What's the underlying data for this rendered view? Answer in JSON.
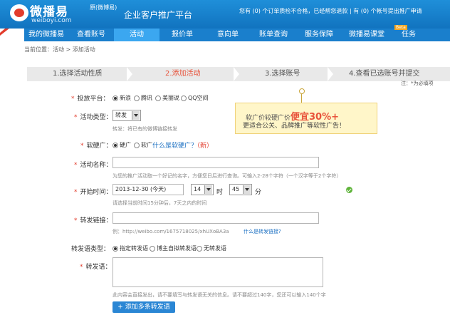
{
  "header": {
    "logo_name": "微播易",
    "logo_sub": "原(微博易)",
    "logo_domain": "weiboyi.com",
    "platform": "企业客户推广平台",
    "notice": "您有 (0) 个订单质检不合格，已经帮您退款 | 有 (0) 个帐号提出推广申请"
  },
  "nav": {
    "tabs": [
      "我的微播易",
      "查看账号",
      "活动",
      "报价单",
      "意向单",
      "账单查询",
      "服务保障",
      "微播易课堂",
      "任务"
    ],
    "active": "活动",
    "beta": "Beta"
  },
  "breadcrumb": "当前位置：活动 > 添加活动",
  "steps": [
    "1.选择活动性质",
    "2.添加活动",
    "3.选择账号",
    "4.查看已选账号并提交"
  ],
  "required_note": "注：*为必填项",
  "form": {
    "platform_label": "投放平台：",
    "platform_options": [
      "新浪",
      "腾讯",
      "美丽说",
      "QQ空间"
    ],
    "type_label": "活动类型：",
    "type_value": "转发",
    "type_hint": "转发：将已有的微博链接转发",
    "ad_label": "软硬广：",
    "ad_options": [
      "硬广",
      "软广"
    ],
    "ad_link": "什么是软硬广？",
    "ad_new": "（新）",
    "name_label": "活动名称：",
    "name_hint": "为您的推广活动取一个好记的名字，方便您日后进行查询。可输入2-28个字符（一个汉字等于2个字符）",
    "start_label": "开始时间：",
    "start_date": "2013-12-30 (今天)",
    "start_hour": "14",
    "hour_unit": "时",
    "start_min": "45",
    "min_unit": "分",
    "start_hint": "请选择当前时间15分钟后，7天之内的时间",
    "link_label": "转发链接：",
    "link_hint": "例：http://weibo.com/1675718025/xhUXoBA3a",
    "link_hint_link": "什么是转发链接?",
    "reason_type_label": "转发语类型：",
    "reason_type_options": [
      "指定转发语",
      "博主自拟转发语",
      "无转发语"
    ],
    "reason_label": "转发语：",
    "reason_hint": "此内容会直接发出，请不要填写与转发语无关的信息。请不要超过140字，您还可以输入140个字",
    "add_button": "+ 添加多条转发语"
  },
  "promo": {
    "line1_pre": "软广价较硬广价",
    "line1_hot": "便宜30%+",
    "line2": "更适合公关、品牌推广等软性广告！"
  },
  "colors": {
    "brand": "#1a7fcc",
    "active_step": "#e8523a",
    "required": "#e23c2c"
  }
}
